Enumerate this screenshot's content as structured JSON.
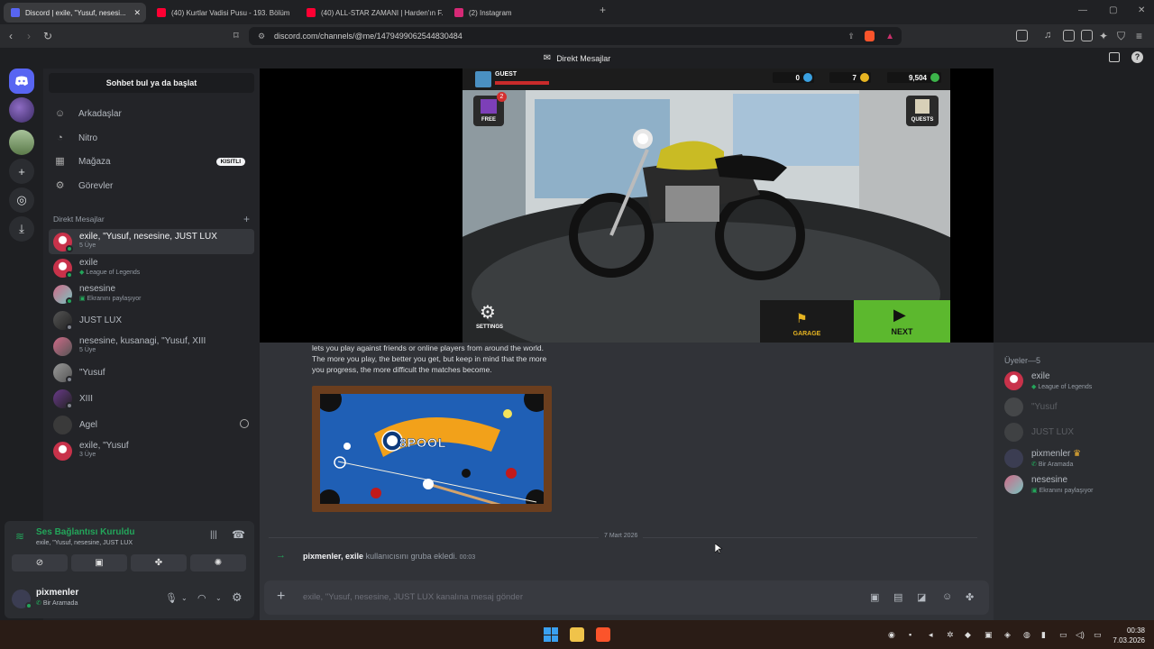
{
  "browser": {
    "tabs": [
      {
        "label": "Discord | exile, \"Yusuf, nesesi...",
        "active": true
      },
      {
        "label": "(40) Kurtlar Vadisi Pusu - 193. Bölüm",
        "active": false
      },
      {
        "label": "(40) ALL-STAR ZAMANI | Harden'ın F...",
        "active": false
      },
      {
        "label": "(2) Instagram",
        "active": false
      }
    ],
    "url": "discord.com/channels/@me/1479499062544830484"
  },
  "window_title": "Direkt Mesajlar",
  "sidebar": {
    "search_label": "Sohbet bul ya da başlat",
    "nav": [
      {
        "label": "Arkadaşlar",
        "icon": "friends-icon"
      },
      {
        "label": "Nitro",
        "icon": "nitro-icon"
      },
      {
        "label": "Mağaza",
        "icon": "shop-icon",
        "badge": "KISITLI"
      },
      {
        "label": "Görevler",
        "icon": "quests-icon"
      }
    ],
    "dm_header": "Direkt Mesajlar",
    "dms": [
      {
        "name": "exile, \"Yusuf, nesesine, JUST LUX",
        "sub": "5 Üye",
        "selected": true
      },
      {
        "name": "exile",
        "sub": "League of Legends"
      },
      {
        "name": "nesesine",
        "sub": "Ekranını paylaşıyor"
      },
      {
        "name": "JUST LUX",
        "sub": ""
      },
      {
        "name": "nesesine, kusanagi, \"Yusuf, XIII",
        "sub": "5 Üye"
      },
      {
        "name": "\"Yusuf",
        "sub": ""
      },
      {
        "name": "XIII",
        "sub": ""
      },
      {
        "name": "Agel",
        "sub": ""
      },
      {
        "name": "exile, \"Yusuf",
        "sub": "3 Üye"
      }
    ]
  },
  "voice": {
    "title": "Ses Bağlantısı Kuruldu",
    "subtitle": "exile, \"Yusuf, nesesine, JUST LUX"
  },
  "user": {
    "name": "pixmenler",
    "status": "Bir Aramada"
  },
  "game": {
    "player": "GUEST",
    "currency1": "0",
    "currency2": "7",
    "currency3": "9,504",
    "free_label": "FREE",
    "free_badge": "2",
    "quests_label": "QUESTS",
    "settings_label": "SETTINGS",
    "garage_label": "GARAGE",
    "next_label": "NEXT"
  },
  "chat": {
    "message_text": "lets you play against friends or online players from around the world. The more you play, the better you get, but keep in mind that the more you progress, the more difficult the matches become.",
    "pool_logo": "8POOL",
    "date_divider": "7 Mart 2026",
    "system_user1": "pixmenler",
    "system_user2": "exile",
    "system_text": "kullanıcısını gruba ekledi.",
    "system_time": "00:03",
    "composer_placeholder": "exile, \"Yusuf, nesesine, JUST LUX kanalına mesaj gönder"
  },
  "members": {
    "header": "Üyeler—5",
    "list": [
      {
        "name": "exile",
        "sub": "League of Legends",
        "online": true,
        "color": "#c8324a"
      },
      {
        "name": "\"Yusuf",
        "sub": "",
        "online": false,
        "color": "#777777"
      },
      {
        "name": "JUST LUX",
        "sub": "",
        "online": false,
        "color": "#666666"
      },
      {
        "name": "pixmenler",
        "sub": "Bir Aramada",
        "online": true,
        "color": "#3b3d52",
        "crown": "♛"
      },
      {
        "name": "nesesine",
        "sub": "Ekranını paylaşıyor",
        "online": true,
        "color": "#d06a88"
      }
    ]
  },
  "taskbar": {
    "time": "00:38",
    "date": "7.03.2026"
  },
  "colors": {
    "accent": "#5865f2",
    "online": "#23a55a",
    "next_green": "#5cb82e"
  }
}
